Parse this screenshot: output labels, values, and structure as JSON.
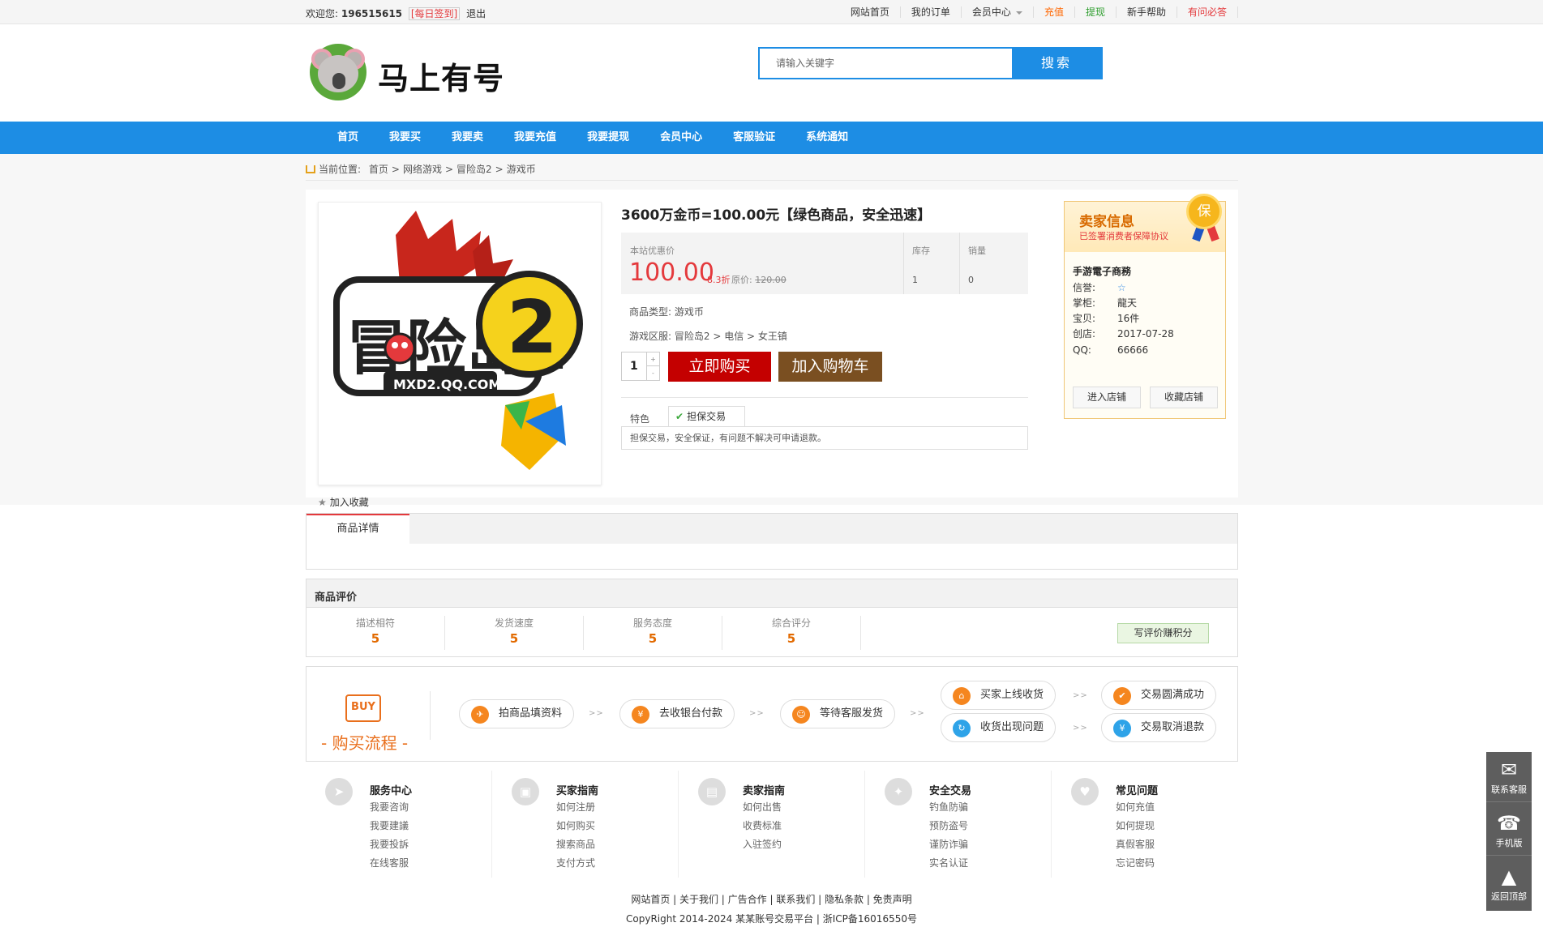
{
  "topbar": {
    "welcome": "欢迎您:",
    "user_id": "196515615",
    "sign_in": "[每日签到]",
    "logout": "退出",
    "links": [
      {
        "label": "网站首页",
        "style": "normal"
      },
      {
        "label": "我的订单",
        "style": "normal"
      },
      {
        "label": "会员中心",
        "style": "dropdown"
      },
      {
        "label": "充值",
        "style": "orange"
      },
      {
        "label": "提现",
        "style": "green"
      },
      {
        "label": "新手帮助",
        "style": "normal"
      },
      {
        "label": "有问必答",
        "style": "red"
      }
    ]
  },
  "header": {
    "logo_text": "马上有号",
    "search_placeholder": "请输入关键字",
    "search_button": "搜索"
  },
  "nav": [
    "首页",
    "我要买",
    "我要卖",
    "我要充值",
    "我要提现",
    "会员中心",
    "客服验证",
    "系统通知"
  ],
  "breadcrumb": {
    "label": "当前位置:",
    "items": [
      "首页",
      "网络游戏",
      "冒险岛2",
      "游戏币"
    ],
    "separator": ">"
  },
  "product": {
    "image_text": "冒险岛2",
    "image_sub": "MXD2.QQ.COM",
    "favorite": "加入收藏",
    "title": "3600万金币=100.00元【绿色商品，安全迅速】",
    "price_label": "本站优惠价",
    "price": "100.00",
    "discount": "8.3折",
    "original_label": "原价:",
    "original_price": "120.00",
    "stock_label": "库存",
    "stock": "1",
    "sales_label": "销量",
    "sales": "0",
    "type_label": "商品类型:",
    "type": "游戏币",
    "server_label": "游戏区服:",
    "server": "冒险岛2 > 电信 > 女王镇",
    "quantity": "1",
    "buy_now": "立即购买",
    "add_cart": "加入购物车",
    "feature_label": "特色",
    "feature_tab": "担保交易",
    "feature_desc": "担保交易，安全保证，有问题不解决可申请退款。"
  },
  "seller": {
    "title": "卖家信息",
    "subtitle": "已签署消费者保障协议",
    "badge": "保",
    "name": "手游電子商務",
    "rows": [
      {
        "k": "信誉:",
        "v": "☆"
      },
      {
        "k": "掌柜:",
        "v": "龍天"
      },
      {
        "k": "宝贝:",
        "v": "16件"
      },
      {
        "k": "创店:",
        "v": "2017-07-28"
      },
      {
        "k": "QQ:",
        "v": "66666"
      }
    ],
    "enter_shop": "进入店铺",
    "fav_shop": "收藏店铺"
  },
  "detail": {
    "tab": "商品详情"
  },
  "review": {
    "title": "商品评价",
    "items": [
      {
        "label": "描述相符",
        "value": "5"
      },
      {
        "label": "发货速度",
        "value": "5"
      },
      {
        "label": "服务态度",
        "value": "5"
      },
      {
        "label": "综合评分",
        "value": "5"
      }
    ],
    "write_button": "写评价赚积分"
  },
  "process": {
    "icon_text": "BUY",
    "title": "- 购买流程 -",
    "steps": [
      "拍商品填资料",
      "去收银台付款",
      "等待客服发货",
      "买家上线收货",
      "交易圆满成功",
      "收货出现问题",
      "交易取消退款"
    ],
    "arrow": ">>"
  },
  "footer_cols": [
    {
      "title": "服务中心",
      "links": [
        "我要咨询",
        "我要建議",
        "我要投訴",
        "在线客服"
      ]
    },
    {
      "title": "买家指南",
      "links": [
        "如何注册",
        "如何购买",
        "搜索商品",
        "支付方式"
      ]
    },
    {
      "title": "卖家指南",
      "links": [
        "如何出售",
        "收费标准",
        "入驻签约"
      ]
    },
    {
      "title": "安全交易",
      "links": [
        "钓鱼防骗",
        "预防盗号",
        "谨防诈骗",
        "实名认证"
      ]
    },
    {
      "title": "常见问题",
      "links": [
        "如何充值",
        "如何提现",
        "真假客服",
        "忘记密码"
      ]
    }
  ],
  "footer_links": "网站首页 | 关于我们 | 广告合作 | 联系我们 | 隐私条款 | 免责声明",
  "copyright": "CopyRight 2014-2024 某某账号交易平台 | 浙ICP备16016550号",
  "side": [
    "联系客服",
    "手机版",
    "返回顶部"
  ],
  "colors": {
    "accent": "#1d8de4",
    "price_red": "#e4393c",
    "buy_red": "#c40000",
    "cart_brown": "#7a4f21",
    "orange": "#e96f1c"
  }
}
